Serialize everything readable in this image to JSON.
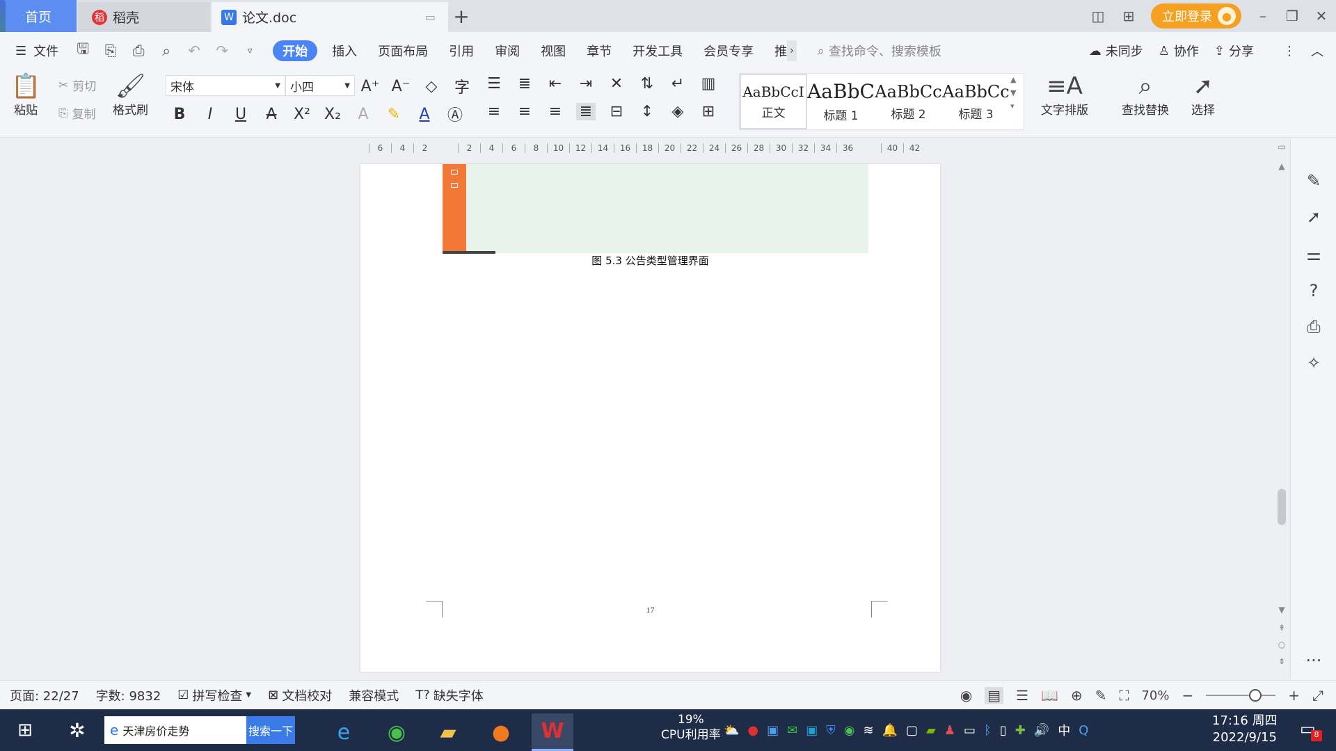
{
  "tabbar": {
    "home_label": "首页",
    "daoke_label": "稻壳",
    "doc_label": "论文.doc",
    "login_label": "立即登录"
  },
  "menubar": {
    "file_label": "文件",
    "items": [
      "开始",
      "插入",
      "页面布局",
      "引用",
      "审阅",
      "视图",
      "章节",
      "开发工具",
      "会员专享",
      "推"
    ],
    "more": "›",
    "search_placeholder": "查找命令、搜索模板",
    "sync_label": "未同步",
    "collab_label": "协作",
    "share_label": "分享"
  },
  "ribbon": {
    "paste": "粘贴",
    "cut": "剪切",
    "copy": "复制",
    "format_painter": "格式刷",
    "font_name": "宋体",
    "font_size": "小四",
    "styles": [
      {
        "sample": "AaBbCcI",
        "label": "正文"
      },
      {
        "sample": "AaBbC",
        "label": "标题 1"
      },
      {
        "sample": "AaBbCc",
        "label": "标题 2"
      },
      {
        "sample": "AaBbCc",
        "label": "标题 3"
      }
    ],
    "text_layout": "文字排版",
    "find_replace": "查找替换",
    "select": "选择"
  },
  "ruler": {
    "ticks": [
      "6",
      "4",
      "2",
      "",
      "2",
      "4",
      "6",
      "8",
      "10",
      "12",
      "14",
      "16",
      "18",
      "20",
      "22",
      "24",
      "26",
      "28",
      "30",
      "32",
      "34",
      "36",
      "",
      "40",
      "42"
    ]
  },
  "document": {
    "figure_caption": "图 5.3 公告类型管理界面",
    "page_number": "17"
  },
  "statusbar": {
    "page": "页面: 22/27",
    "word_count": "字数: 9832",
    "spell_check": "拼写检查",
    "doc_proof": "文档校对",
    "compat_mode": "兼容模式",
    "missing_font": "缺失字体",
    "zoom": "70%"
  },
  "taskbar": {
    "search_text": "天津房价走势",
    "search_button": "搜索一下",
    "cpu_percent": "19%",
    "cpu_label": "CPU利用率",
    "ime": "中",
    "time": "17:16 周四",
    "date": "2022/9/15",
    "notif_count": "8"
  },
  "colors": {
    "accent": "#4a84f6",
    "login": "#f5a021",
    "figure_sidebar": "#f37736",
    "taskbar": "#1e2c48"
  }
}
